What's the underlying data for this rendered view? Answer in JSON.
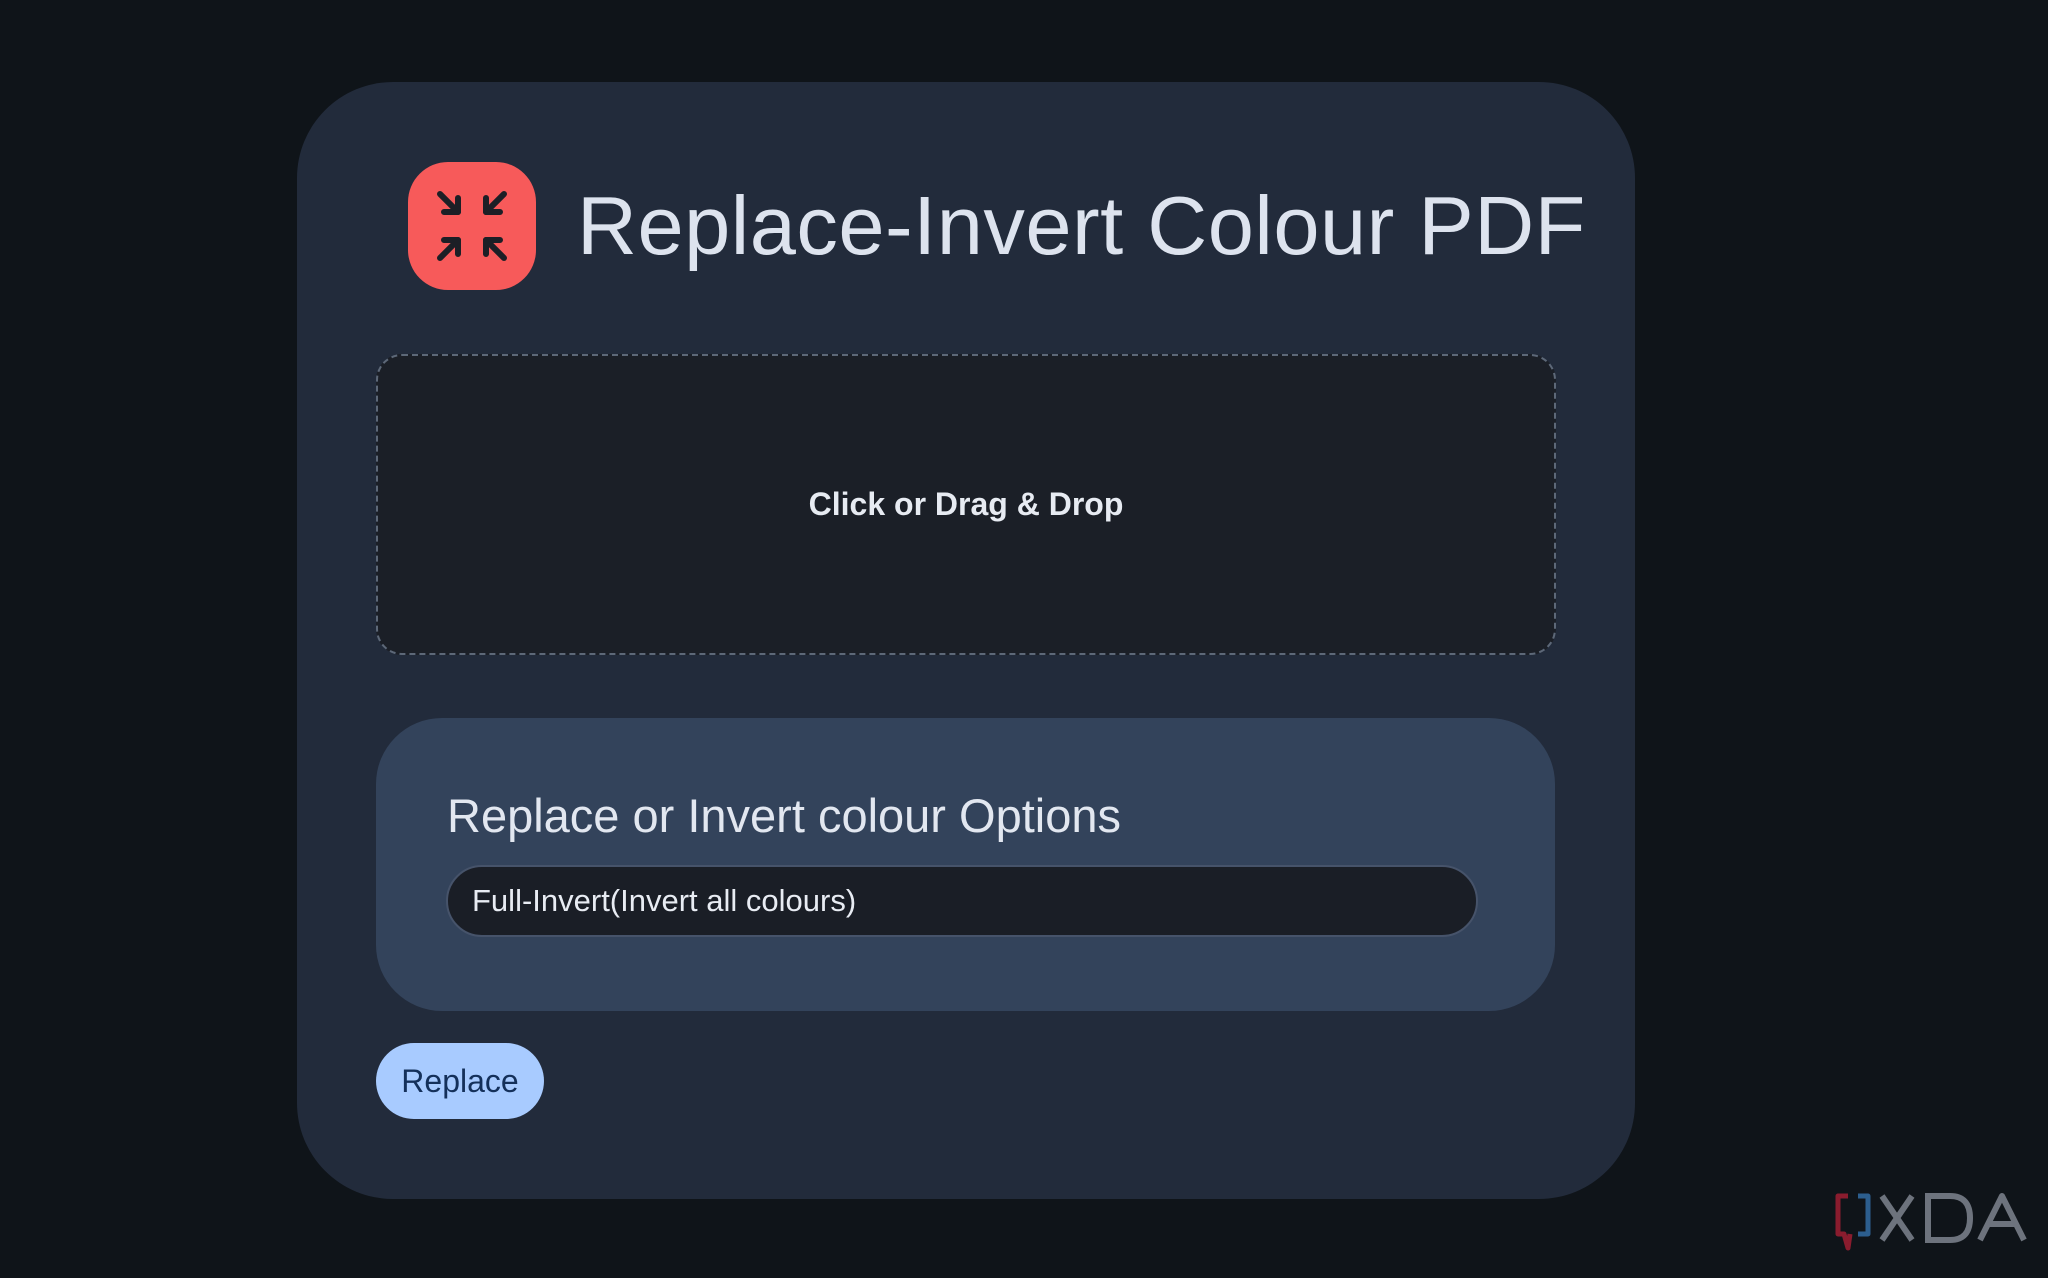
{
  "app": {
    "title": "Replace-Invert Colour PDF",
    "icon": "compress-arrows-icon",
    "icon_color": "#f75a5a"
  },
  "dropzone": {
    "label": "Click or Drag & Drop"
  },
  "options": {
    "title": "Replace or Invert colour Options",
    "selected_value": "Full-Invert(Invert all colours)"
  },
  "actions": {
    "replace_label": "Replace"
  },
  "watermark": {
    "text": "XDA"
  },
  "colors": {
    "page_background": "#0f1419",
    "card_background": "#222b3b",
    "options_panel": "#33435b",
    "button_background": "#a8cbff",
    "button_text": "#14305a"
  }
}
